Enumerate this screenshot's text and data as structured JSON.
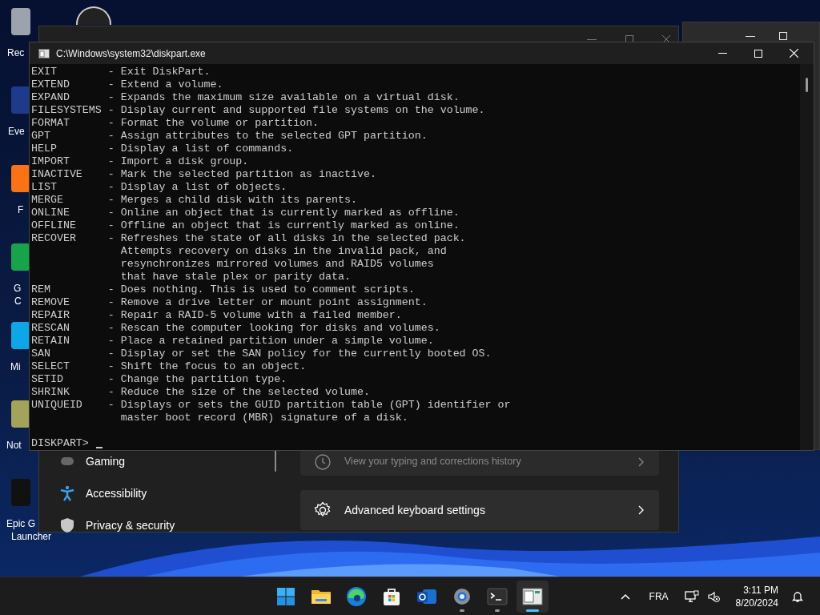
{
  "desktop_icons": [
    {
      "lines": [
        "Rec"
      ],
      "color": "#9ca3af"
    },
    {
      "lines": [
        "Eve"
      ],
      "color": "#1e3a8a"
    },
    {
      "lines": [
        "F"
      ],
      "color": "#f97316"
    },
    {
      "lines": [
        "G",
        "C"
      ],
      "color": "#16a34a"
    },
    {
      "lines": [
        "Mi"
      ],
      "color": "#0ea5e9"
    },
    {
      "lines": [
        "Not"
      ],
      "color": "#a3a35a"
    },
    {
      "lines": [
        "Epic G",
        "Launcher"
      ],
      "color": "#111111"
    }
  ],
  "settings_window": {
    "nav_items": [
      {
        "label": "Gaming",
        "kind": "gaming"
      },
      {
        "label": "Accessibility",
        "kind": "accessibility"
      },
      {
        "label": "Privacy & security",
        "kind": "privacy"
      }
    ],
    "cards": [
      {
        "kind": "history",
        "subtitle": "View your typing and corrections history"
      },
      {
        "kind": "gear",
        "title": "Advanced keyboard settings"
      }
    ]
  },
  "console": {
    "title": "C:\\Windows\\system32\\diskpart.exe",
    "lines": [
      "EXIT        - Exit DiskPart.",
      "EXTEND      - Extend a volume.",
      "EXPAND      - Expands the maximum size available on a virtual disk.",
      "FILESYSTEMS - Display current and supported file systems on the volume.",
      "FORMAT      - Format the volume or partition.",
      "GPT         - Assign attributes to the selected GPT partition.",
      "HELP        - Display a list of commands.",
      "IMPORT      - Import a disk group.",
      "INACTIVE    - Mark the selected partition as inactive.",
      "LIST        - Display a list of objects.",
      "MERGE       - Merges a child disk with its parents.",
      "ONLINE      - Online an object that is currently marked as offline.",
      "OFFLINE     - Offline an object that is currently marked as online.",
      "RECOVER     - Refreshes the state of all disks in the selected pack.",
      "              Attempts recovery on disks in the invalid pack, and",
      "              resynchronizes mirrored volumes and RAID5 volumes",
      "              that have stale plex or parity data.",
      "REM         - Does nothing. This is used to comment scripts.",
      "REMOVE      - Remove a drive letter or mount point assignment.",
      "REPAIR      - Repair a RAID-5 volume with a failed member.",
      "RESCAN      - Rescan the computer looking for disks and volumes.",
      "RETAIN      - Place a retained partition under a simple volume.",
      "SAN         - Display or set the SAN policy for the currently booted OS.",
      "SELECT      - Shift the focus to an object.",
      "SETID       - Change the partition type.",
      "SHRINK      - Reduce the size of the selected volume.",
      "UNIQUEID    - Displays or sets the GUID partition table (GPT) identifier or",
      "              master boot record (MBR) signature of a disk."
    ],
    "prompt": "DISKPART>"
  },
  "taskbar": {
    "apps": [
      {
        "kind": "start",
        "running": false,
        "selected": false
      },
      {
        "kind": "folder",
        "running": false,
        "selected": false
      },
      {
        "kind": "edge",
        "running": false,
        "selected": false
      },
      {
        "kind": "store",
        "running": false,
        "selected": false
      },
      {
        "kind": "mail",
        "running": false,
        "selected": false
      },
      {
        "kind": "settings",
        "running": true,
        "selected": false
      },
      {
        "kind": "terminal",
        "running": true,
        "selected": false
      },
      {
        "kind": "console",
        "running": true,
        "selected": true
      }
    ],
    "language": "FRA",
    "time": "3:11 PM",
    "date": "8/20/2024"
  }
}
